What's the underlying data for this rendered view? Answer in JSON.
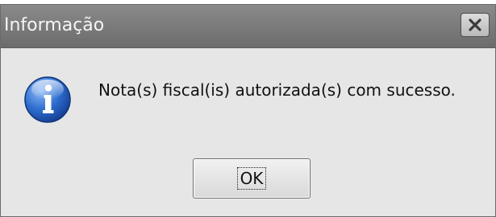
{
  "dialog": {
    "title": "Informação",
    "message": "Nota(s) fiscal(is) autorizada(s) com sucesso.",
    "ok_label": "OK",
    "icons": {
      "close": "close-icon",
      "info": "info-icon"
    },
    "colors": {
      "titlebar": "#7b7b7b",
      "body": "#e6e6e6",
      "info_icon": "#2a66c9"
    }
  }
}
